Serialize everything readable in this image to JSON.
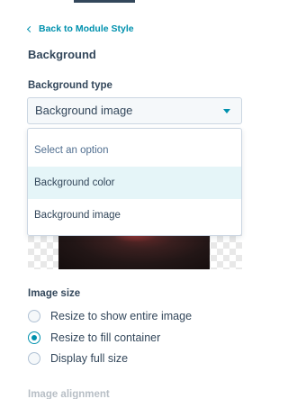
{
  "back_link": {
    "label": "Back to Module Style"
  },
  "section": {
    "title": "Background"
  },
  "background_type": {
    "label": "Background type",
    "selected": "Background image",
    "options": [
      {
        "label": "Select an option",
        "placeholder": true
      },
      {
        "label": "Background color",
        "highlighted": true
      },
      {
        "label": "Background image"
      }
    ]
  },
  "image_size": {
    "label": "Image size",
    "options": [
      {
        "label": "Resize to show entire image",
        "checked": false
      },
      {
        "label": "Resize to fill container",
        "checked": true
      },
      {
        "label": "Display full size",
        "checked": false
      }
    ]
  },
  "next_section": {
    "label": "Image alignment"
  },
  "colors": {
    "accent": "#0091ae",
    "text": "#33475b",
    "highlight": "#e5f5f8",
    "border": "#cbd6e2"
  }
}
